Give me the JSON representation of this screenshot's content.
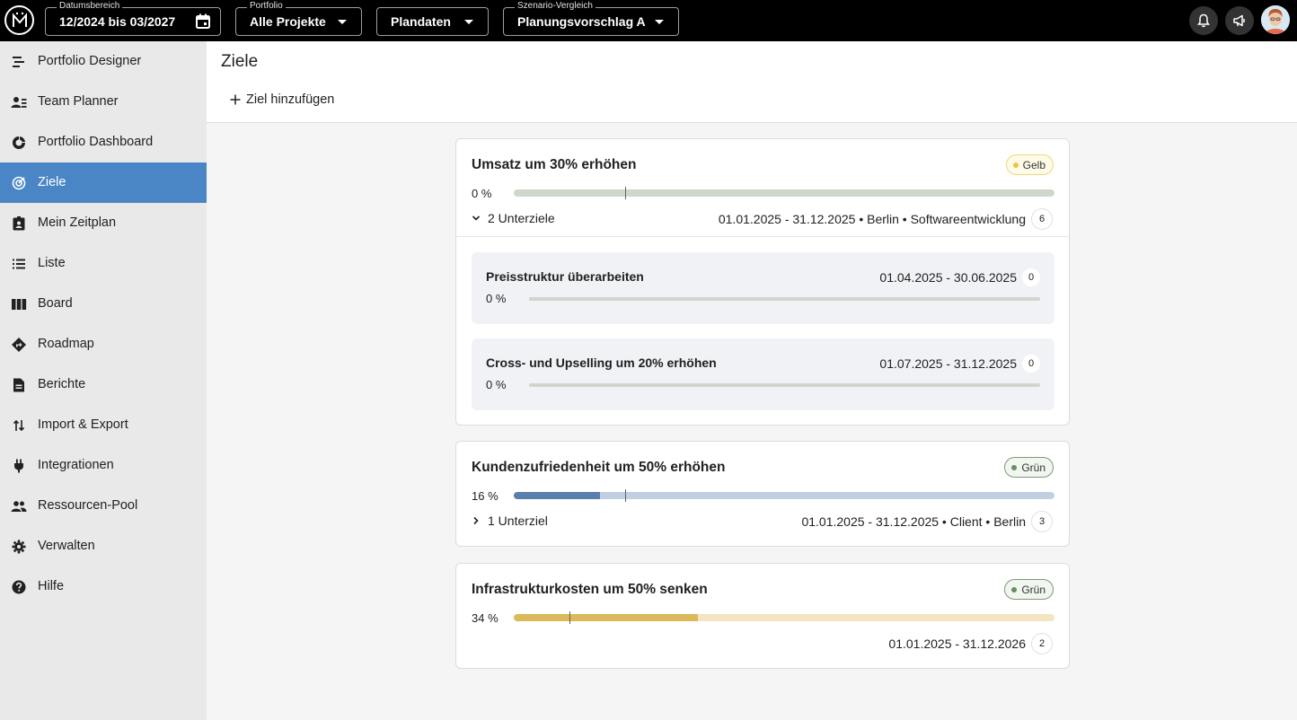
{
  "topbar": {
    "date_range": {
      "label": "Datumsbereich",
      "value": "12/2024 bis 03/2027"
    },
    "portfolio": {
      "label": "Portfolio",
      "value": "Alle Projekte"
    },
    "data_source": {
      "value": "Plandaten"
    },
    "scenario": {
      "label": "Szenario-Vergleich",
      "value": "Planungsvorschlag A"
    }
  },
  "sidebar": {
    "items": [
      {
        "label": "Portfolio Designer",
        "icon": "portfolio-designer-icon"
      },
      {
        "label": "Team Planner",
        "icon": "team-planner-icon"
      },
      {
        "label": "Portfolio Dashboard",
        "icon": "donut-chart-icon"
      },
      {
        "label": "Ziele",
        "icon": "target-icon",
        "active": true
      },
      {
        "label": "Mein Zeitplan",
        "icon": "badge-icon"
      },
      {
        "label": "Liste",
        "icon": "list-icon"
      },
      {
        "label": "Board",
        "icon": "columns-icon"
      },
      {
        "label": "Roadmap",
        "icon": "directions-icon"
      },
      {
        "label": "Berichte",
        "icon": "document-icon"
      },
      {
        "label": "Import & Export",
        "icon": "import-export-icon"
      },
      {
        "label": "Integrationen",
        "icon": "plug-icon"
      },
      {
        "label": "Ressourcen-Pool",
        "icon": "people-icon"
      },
      {
        "label": "Verwalten",
        "icon": "gear-icon"
      },
      {
        "label": "Hilfe",
        "icon": "help-icon"
      }
    ]
  },
  "main": {
    "title": "Ziele",
    "add_goal_label": "Ziel hinzufügen"
  },
  "goals": [
    {
      "title": "Umsatz um 30% erhöhen",
      "status": "Gelb",
      "status_color": "#e9c544",
      "progress_label": "0 %",
      "progress": 0,
      "subgoals_label": "2 Unterziele",
      "expanded": true,
      "meta": "01.01.2025 - 31.12.2025  •  Berlin  •  Softwareentwicklung",
      "count": "6",
      "bar_track_color": "#cfd7cb",
      "bar_fill_color": "#cfd7cb",
      "subgoals": [
        {
          "title": "Preisstruktur überarbeiten",
          "dates": "01.04.2025 - 30.06.2025",
          "count": "0",
          "progress_label": "0 %"
        },
        {
          "title": "Cross- und Upselling um 20% erhöhen",
          "dates": "01.07.2025 - 31.12.2025",
          "count": "0",
          "progress_label": "0 %"
        }
      ]
    },
    {
      "title": "Kundenzufriedenheit um 50% erhöhen",
      "status": "Grün",
      "status_color": "#6b8b66",
      "progress_label": "16 %",
      "progress": 16,
      "subgoals_label": "1 Unterziel",
      "expanded": false,
      "meta": "01.01.2025 - 31.12.2025  •  Client  •  Berlin",
      "count": "3",
      "bar_track_color": "#c1cfe2",
      "bar_fill_color": "#5b7fad"
    },
    {
      "title": "Infrastrukturkosten um 50% senken",
      "status": "Grün",
      "status_color": "#6b8b66",
      "progress_label": "34 %",
      "progress": 34,
      "meta": "01.01.2025 - 31.12.2026",
      "count": "2",
      "bar_track_color": "#f3e5bf",
      "bar_fill_color": "#dcb95a"
    }
  ]
}
